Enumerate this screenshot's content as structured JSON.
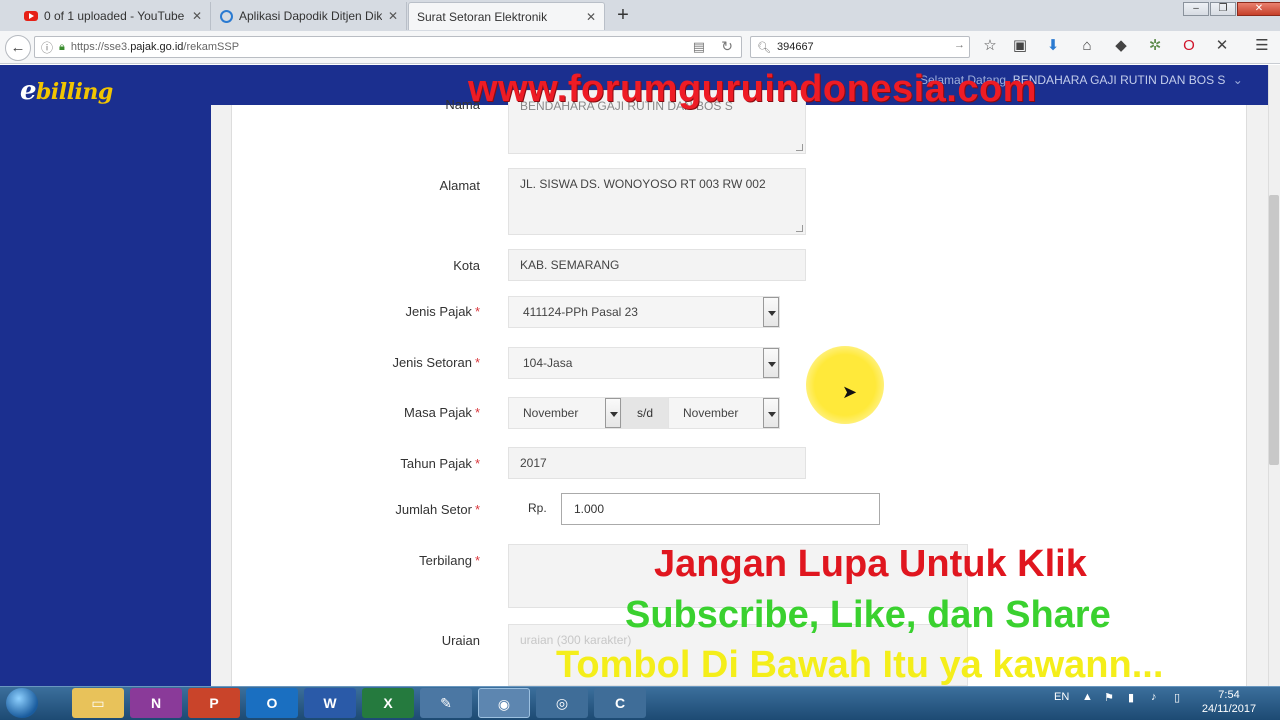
{
  "browser": {
    "tabs": [
      {
        "label": "0 of 1 uploaded - YouTube",
        "icon": "youtube-icon"
      },
      {
        "label": "Aplikasi Dapodik Ditjen Dikd",
        "icon": "globe-icon"
      },
      {
        "label": "Surat Setoran Elektronik",
        "icon": "none"
      }
    ],
    "url_prefix": "https://sse3.",
    "url_domain": "pajak.go.id",
    "url_path": "/rekamSSP",
    "search_value": "394667"
  },
  "app": {
    "logo_e": "e",
    "logo_billing": "billing",
    "welcome_prefix": "Selamat Datang, ",
    "welcome_user": "BENDAHARA GAJI RUTIN DAN BOS S"
  },
  "form": {
    "nama_label": "Nama",
    "nama_value": "BENDAHARA GAJI RUTIN DAN BOS S",
    "alamat_label": "Alamat",
    "alamat_value": "JL. SISWA DS. WONOYOSO RT 003 RW 002",
    "kota_label": "Kota",
    "kota_value": "KAB. SEMARANG",
    "jenis_pajak_label": "Jenis Pajak",
    "jenis_pajak_value": "411124-PPh Pasal 23",
    "jenis_setoran_label": "Jenis Setoran",
    "jenis_setoran_value": "104-Jasa",
    "masa_pajak_label": "Masa Pajak",
    "masa_dari": "November",
    "sd_label": "s/d",
    "masa_sampai": "November",
    "tahun_pajak_label": "Tahun Pajak",
    "tahun_pajak_value": "2017",
    "jumlah_setor_label": "Jumlah Setor",
    "currency": "Rp.",
    "jumlah_setor_value": "1.000",
    "terbilang_label": "Terbilang",
    "uraian_label": "Uraian",
    "uraian_placeholder": "uraian (300 karakter)",
    "required_mark": "*"
  },
  "overlay": {
    "site": "www.forumguruindonesia.com",
    "line1": "Jangan Lupa Untuk Klik",
    "line2": "Subscribe, Like, dan Share",
    "line3": "Tombol Di Bawah Itu ya kawann..."
  },
  "taskbar": {
    "lang": "EN",
    "time": "7:54",
    "date": "24/11/2017"
  },
  "colors": {
    "header_blue": "#1b2f8f",
    "required_red": "#d9353b",
    "logo_yellow": "#f2c500"
  }
}
